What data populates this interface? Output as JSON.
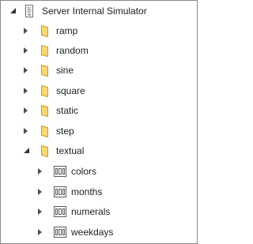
{
  "tree": {
    "root": {
      "label": "Server Internal Simulator",
      "icon": "server-icon",
      "expanded": true
    },
    "folders": [
      {
        "label": "ramp",
        "icon": "folder-icon",
        "expanded": false
      },
      {
        "label": "random",
        "icon": "folder-icon",
        "expanded": false
      },
      {
        "label": "sine",
        "icon": "folder-icon",
        "expanded": false
      },
      {
        "label": "square",
        "icon": "folder-icon",
        "expanded": false
      },
      {
        "label": "static",
        "icon": "folder-icon",
        "expanded": false
      },
      {
        "label": "step",
        "icon": "folder-icon",
        "expanded": false
      },
      {
        "label": "textual",
        "icon": "folder-icon",
        "expanded": true
      }
    ],
    "textual_children": [
      {
        "label": "colors",
        "icon": "variable-icon",
        "expanded": false
      },
      {
        "label": "months",
        "icon": "variable-icon",
        "expanded": false
      },
      {
        "label": "numerals",
        "icon": "variable-icon",
        "expanded": false
      },
      {
        "label": "weekdays",
        "icon": "variable-icon",
        "expanded": false
      }
    ]
  },
  "colors": {
    "text": "#1e1e1e",
    "border": "#8a8a8a",
    "folder_fill": "#f8d775",
    "folder_stroke": "#c69b2b",
    "expander": "#4d4d4d",
    "variable_icon": "#5a5a5a"
  }
}
